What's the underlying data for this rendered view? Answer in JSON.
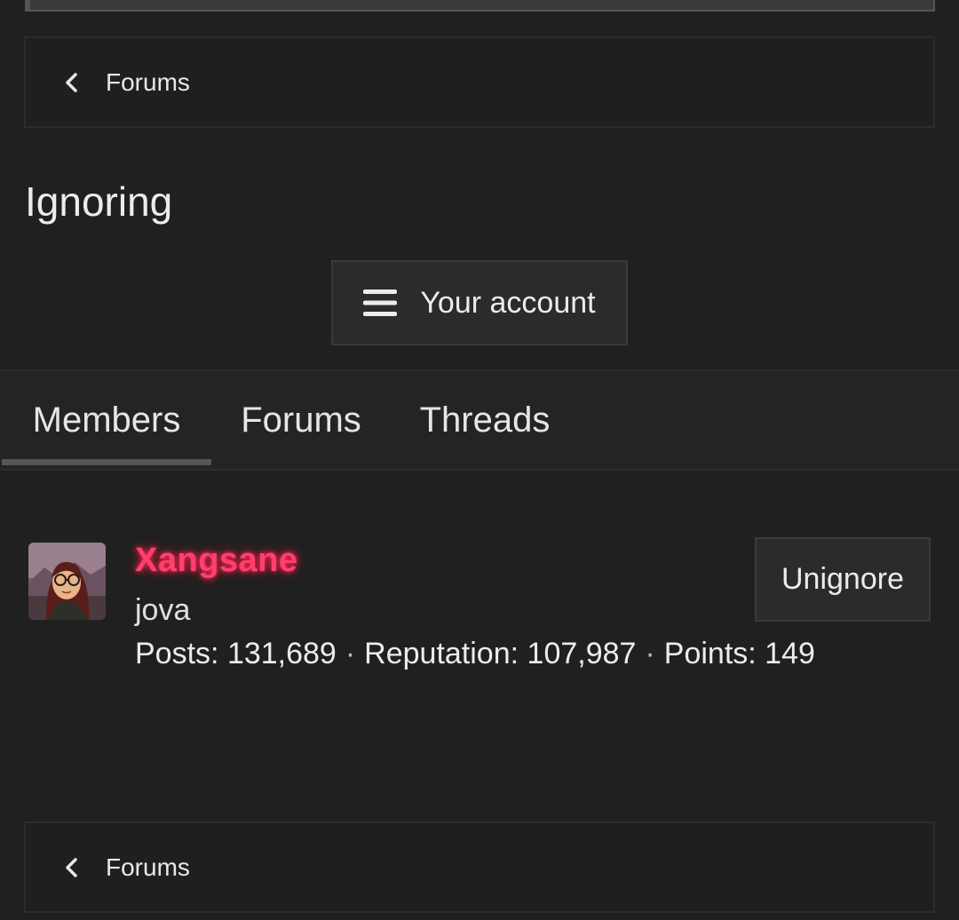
{
  "breadcrumb_top": {
    "label": "Forums"
  },
  "page": {
    "title": "Ignoring"
  },
  "account_menu": {
    "label": "Your account"
  },
  "tabs": [
    {
      "label": "Members",
      "active": true
    },
    {
      "label": "Forums",
      "active": false
    },
    {
      "label": "Threads",
      "active": false
    }
  ],
  "member": {
    "username": "Xangsane",
    "username_color": "#ff3f6e",
    "user_title": "jova",
    "posts_label": "Posts:",
    "posts": "131,689",
    "reputation_label": "Reputation:",
    "reputation": "107,987",
    "points_label": "Points:",
    "points": "149",
    "separator": "·",
    "action_label": "Unignore"
  },
  "breadcrumb_bottom": {
    "label": "Forums"
  },
  "icons": {
    "back": "chevron-left-icon",
    "menu": "hamburger-menu-icon"
  }
}
